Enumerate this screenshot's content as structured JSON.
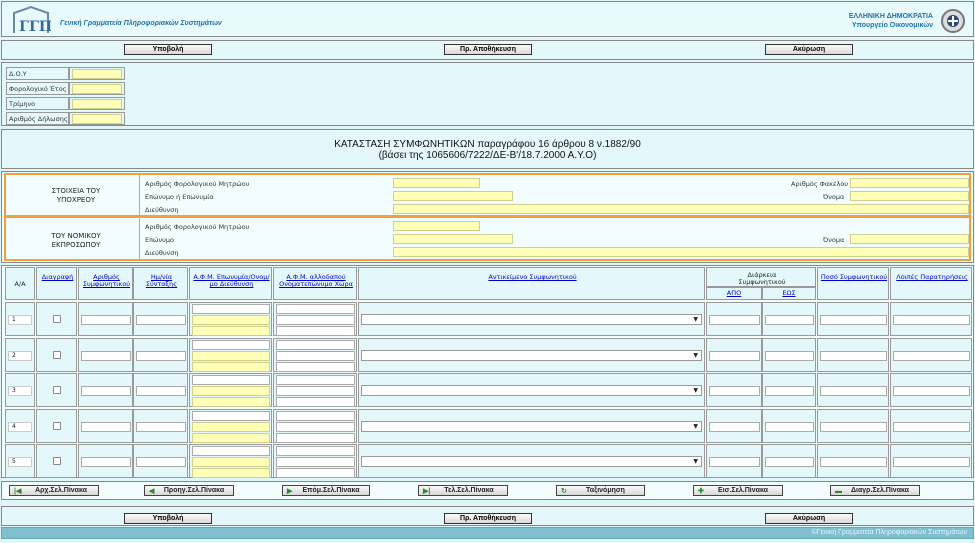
{
  "header": {
    "org_name": "Γενική Γραμματεία Πληροφοριακών Συστημάτων",
    "republic": "ΕΛΛΗΝΙΚΗ ΔΗΜΟΚΡΑΤΙΑ",
    "ministry": "Υπουργείο Οικονομικών"
  },
  "toolbar": {
    "submit": "Υποβολή",
    "temp_save": "Πρ. Αποθήκευση",
    "cancel": "Ακύρωση"
  },
  "meta_fields": [
    {
      "label": "Δ.Ο.Υ",
      "value": ""
    },
    {
      "label": "Φορολογικό Έτος",
      "value": ""
    },
    {
      "label": "Τρίμηνο",
      "value": ""
    },
    {
      "label": "Αριθμός Δήλωσης",
      "value": ""
    }
  ],
  "title": {
    "line1": "ΚΑΤΑΣΤΑΣΗ ΣΥΜΦΩΝΗΤΙΚΩΝ παραγράφου 16 άρθρου 8 ν.1882/90",
    "line2": "(βάσει της 1065606/7222/ΔΕ-Β'/18.7.2000 Α.Υ.Ο)"
  },
  "obligor": {
    "section": "ΣΤΟΙΧΕΙΑ ΤΟΥ ΥΠΟΧΡΕΟΥ",
    "afm": "Αριθμός Φορολογικού Μητρώου",
    "file_no": "Αριθμός Φακέλου",
    "surname": "Επώνυμο ή Επωνυμία",
    "name": "Όνομα",
    "address": "Διεύθυνση"
  },
  "representative": {
    "section": "ΤΟΥ ΝΟΜΙΚΟΥ ΕΚΠΡΟΣΩΠΟΥ",
    "afm": "Αριθμός Φορολογικού Μητρώου",
    "surname": "Επώνυμο",
    "name": "Όνομα",
    "address": "Διεύθυνση"
  },
  "table": {
    "col_aa": "Α/Α",
    "col_delete": "Διαγραφή",
    "col_contract_no": "Αριθμός Συμφωνητικού",
    "col_date": "Ημ/νία Σύνταξης",
    "col_afm": "Α.Φ.Μ. Επωνυμία/Ονομ/μο Διεύθυνση",
    "col_foreign_afm": "Α.Φ.Μ. αλλοδαπού Ονοματεπώνυμο Χώρα",
    "col_subject": "Αντικείμενο Συμφωνητικού",
    "col_duration": "Διάρκεια Συμφωνητικού",
    "col_from": "ΑΠΟ",
    "col_to": "ΕΩΣ",
    "col_amount": "Ποσό Συμφωνητικού",
    "col_notes": "Λοιπές Παρατηρήσεις",
    "rows": [
      "1",
      "2",
      "3",
      "4",
      "5"
    ]
  },
  "pager": {
    "first": "Αρχ.Σελ.Πίνακα",
    "prev": "Προηγ.Σελ.Πίνακα",
    "next": "Επόμ.Σελ.Πίνακα",
    "last": "Τελ.Σελ.Πίνακα",
    "sort": "Ταξινόμηση",
    "insert": "Εισ.Σελ.Πίνακα",
    "delete": "Διαγρ.Σελ.Πίνακα"
  },
  "footer": {
    "copyright": "©Γενική Γραμματεία Πληροφοριακών Συστημάτων"
  }
}
